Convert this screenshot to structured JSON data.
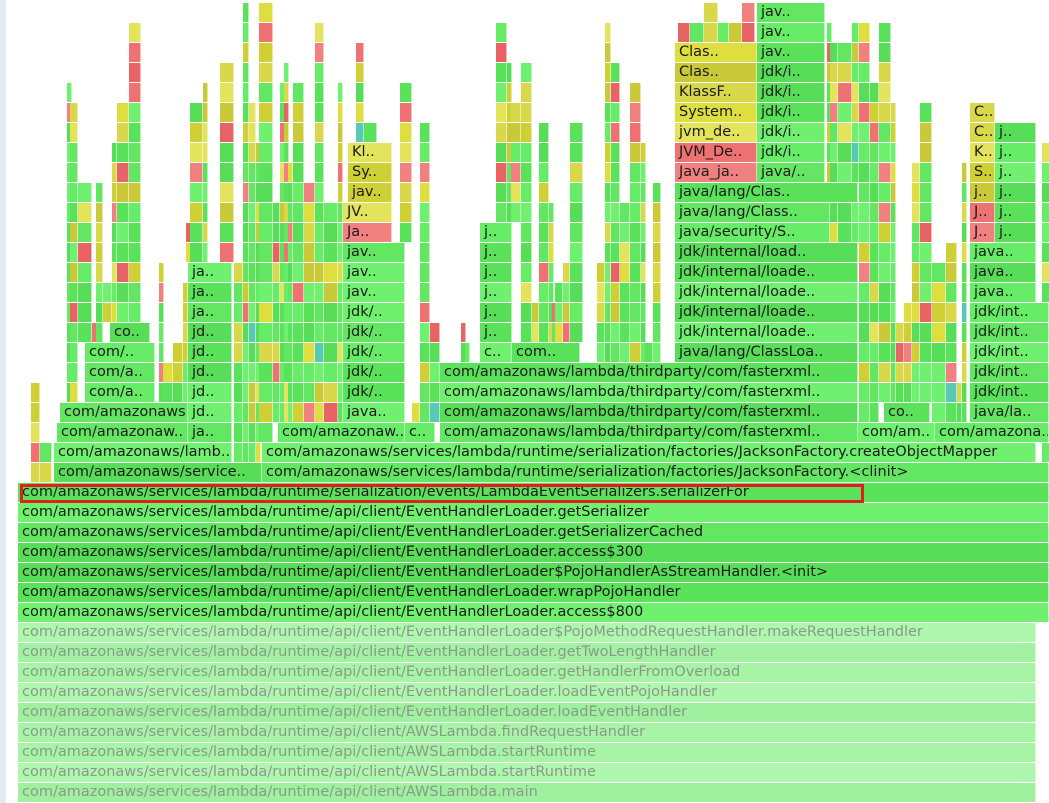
{
  "flame_graph": {
    "stack_frames": [
      "com/amazonaws/services/lambda/runtime/api/client/AWSLambda.main",
      "com/amazonaws/services/lambda/runtime/api/client/AWSLambda.startRuntime",
      "com/amazonaws/services/lambda/runtime/api/client/AWSLambda.startRuntime",
      "com/amazonaws/services/lambda/runtime/api/client/AWSLambda.findRequestHandler",
      "com/amazonaws/services/lambda/runtime/api/client/EventHandlerLoader.loadEventHandler",
      "com/amazonaws/services/lambda/runtime/api/client/EventHandlerLoader.loadEventPojoHandler",
      "com/amazonaws/services/lambda/runtime/api/client/EventHandlerLoader.getHandlerFromOverload",
      "com/amazonaws/services/lambda/runtime/api/client/EventHandlerLoader.getTwoLengthHandler",
      "com/amazonaws/services/lambda/runtime/api/client/EventHandlerLoader$PojoMethodRequestHandler.makeRequestHandler",
      "com/amazonaws/services/lambda/runtime/api/client/EventHandlerLoader.access$800",
      "com/amazonaws/services/lambda/runtime/api/client/EventHandlerLoader.wrapPojoHandler",
      "com/amazonaws/services/lambda/runtime/api/client/EventHandlerLoader$PojoHandlerAsStreamHandler.<init>",
      "com/amazonaws/services/lambda/runtime/api/client/EventHandlerLoader.access$300",
      "com/amazonaws/services/lambda/runtime/api/client/EventHandlerLoader.getSerializerCached",
      "com/amazonaws/services/lambda/runtime/api/client/EventHandlerLoader.getSerializer",
      "com/amazonaws/services/lambda/runtime/serialization/events/LambdaEventSerializers.serializerFor"
    ],
    "highlighted_frame": "com/amazonaws/services/lambda/runtime/serialization/events/LambdaEventSerializers.serializerFor",
    "labels": {
      "jackson_clinit": "com/amazonaws/services/lambda/runtime/serialization/factories/JacksonFactory.<clinit>",
      "jackson_create_mapper": "com/amazonaws/services/lambda/runtime/serialization/factories/JacksonFactory.createObjectMapper",
      "service_short": "com/amazonaws/service..",
      "lamb_short": "com/amazonaws/lamb..",
      "amazonaw_short": "com/amazonaw..",
      "amazona_short": "com/amazona..",
      "amazonaw2_short": "com/amazonaw..",
      "am_short": "com/am..",
      "amazonaws_short": "com/amazonaws..",
      "a_short": "com/a..",
      "com_short": "com/..",
      "co_short": "co..",
      "c_short": "c..",
      "com_dots": "com..",
      "fasterxml": "com/amazonaws/lambda/thirdparty/com/fasterxml..",
      "ja": "ja..",
      "jd": "jd..",
      "jdk": "jdk/..",
      "jav": "jav..",
      "java": "java..",
      "j": "j..",
      "Ja": "Ja..",
      "JV": "JV..",
      "Sy": "Sy..",
      "Kl": "Kl..",
      "C": "C..",
      "K": "K..",
      "S": "S..",
      "J": "J..",
      "jdk_int": "jdk/int..",
      "java_la": "java/la..",
      "java_a": "java..",
      "class_loa": "java/lang/ClassLoa..",
      "jdk_internal_loade": "jdk/internal/loade..",
      "jdk_internal_load": "jdk/internal/load..",
      "java_security": "java/security/S..",
      "java_lang_class_dot": "java/lang/Class..",
      "java_lang_clas": "java/lang/Clas..",
      "java_ja": "Java_ja..",
      "jvm_de_up": "JVM_De..",
      "jvm_de": "jvm_de..",
      "system": "System..",
      "klassf": "KlassF..",
      "clas": "Clas..",
      "java_slash": "java/..",
      "jdk_i": "jdk/i..",
      "jav_top": "jav.."
    }
  }
}
